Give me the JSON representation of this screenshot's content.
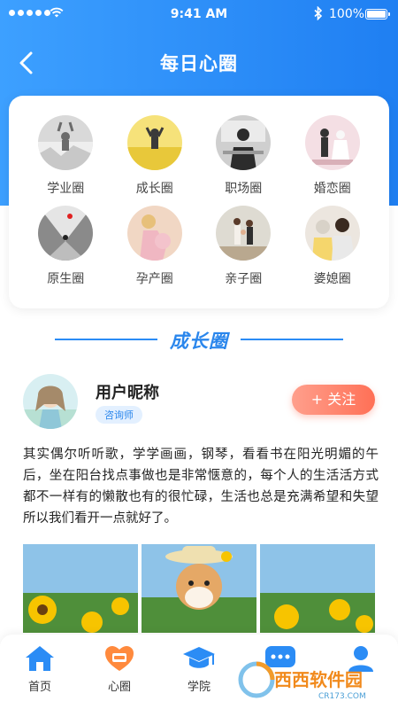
{
  "status_bar": {
    "time": "9:41 AM",
    "battery": "100%"
  },
  "nav": {
    "title": "每日心圈"
  },
  "circles": [
    {
      "label": "学业圈"
    },
    {
      "label": "成长圈"
    },
    {
      "label": "职场圈"
    },
    {
      "label": "婚恋圈"
    },
    {
      "label": "原生圈"
    },
    {
      "label": "孕产圈"
    },
    {
      "label": "亲子圈"
    },
    {
      "label": "婆媳圈"
    }
  ],
  "section": {
    "title": "成长圈"
  },
  "post": {
    "nickname": "用户昵称",
    "tag": "咨询师",
    "follow_label": "+ 关注",
    "content": "其实偶尔听听歌，学学画画，钢琴，看看书在阳光明媚的午后，坐在阳台找点事做也是非常惬意的，每个人的生活活方式都不一样有的懒散也有的很忙碌，生活也总是充满希望和失望所以我们看开一点就好了。"
  },
  "tabs": [
    {
      "label": "首页",
      "icon": "home-icon"
    },
    {
      "label": "心圈",
      "icon": "chat-icon"
    },
    {
      "label": "学院",
      "icon": "graduation-cap-icon"
    },
    {
      "label": "",
      "icon": "message-icon"
    },
    {
      "label": "",
      "icon": "user-icon"
    }
  ],
  "watermark": {
    "name": "西西软件园",
    "domain": "CR173.COM"
  },
  "colors": {
    "primary": "#2a86ec",
    "follow": "#ff7a60",
    "home_tab": "#2b8cf5",
    "circle_tab": "#ff8a3d"
  }
}
